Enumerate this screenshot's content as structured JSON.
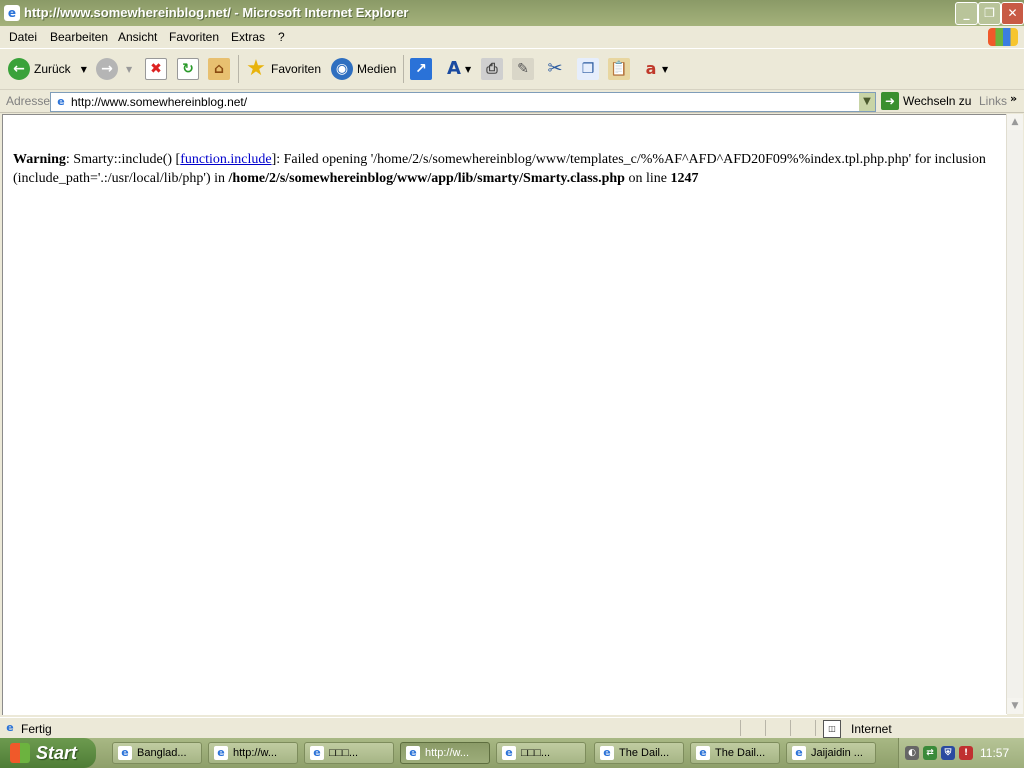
{
  "window": {
    "title": "http://www.somewhereinblog.net/ - Microsoft Internet Explorer"
  },
  "menu": [
    "Datei",
    "Bearbeiten",
    "Ansicht",
    "Favoriten",
    "Extras",
    "?"
  ],
  "toolbar": {
    "back_label": "Zurück",
    "favorites_label": "Favoriten",
    "media_label": "Medien"
  },
  "address": {
    "label": "Adresse",
    "url": "http://www.somewhereinblog.net/",
    "go_label": "Wechseln zu",
    "links_label": "Links"
  },
  "page": {
    "warning_label": "Warning",
    "text1": ": Smarty::include() [",
    "link_text": "function.include",
    "text2": "]: Failed opening '/home/2/s/somewhereinblog/www/templates_c/%%AF^AFD^AFD20F09%%index.tpl.php.php' for inclusion (include_path='.:/usr/local/lib/php') in ",
    "file_path": "/home/2/s/somewhereinblog/www/app/lib/smarty/Smarty.class.php",
    "text3": " on line ",
    "line_number": "1247"
  },
  "status": {
    "text": "Fertig",
    "zone": "Internet"
  },
  "taskbar": {
    "start_label": "Start",
    "tasks": [
      {
        "label": "Banglad...",
        "active": false
      },
      {
        "label": "http://w...",
        "active": false
      },
      {
        "label": "□□□...",
        "active": false
      },
      {
        "label": "http://w...",
        "active": true
      },
      {
        "label": "□□□...",
        "active": false
      },
      {
        "label": "The Dail...",
        "active": false
      },
      {
        "label": "The Dail...",
        "active": false
      },
      {
        "label": "Jaijaidin ...",
        "active": false
      }
    ],
    "clock": "11:57"
  }
}
